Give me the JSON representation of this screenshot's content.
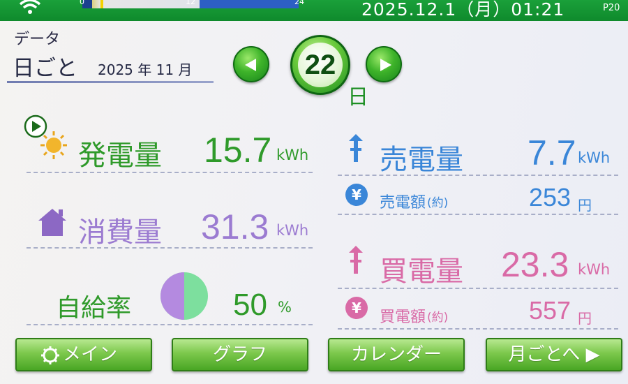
{
  "status_bar": {
    "timeline_ticks": [
      "0",
      "12",
      "24"
    ],
    "datetime": "2025.12.1（月）01:21",
    "page_id": "P20"
  },
  "header": {
    "section": "データ",
    "mode": "日ごと",
    "year_month": "2025 年 11 月",
    "day": "22",
    "day_unit": "日"
  },
  "metrics": {
    "generation": {
      "label": "発電量",
      "value": "15.7",
      "unit": "kWh"
    },
    "consumption": {
      "label": "消費量",
      "value": "31.3",
      "unit": "kWh"
    },
    "self_sufficiency": {
      "label": "自給率",
      "value": "50",
      "unit": "%",
      "fraction": 0.5
    },
    "sold": {
      "label": "売電量",
      "value": "7.7",
      "unit": "kWh"
    },
    "sold_amount": {
      "label": "売電額",
      "note": "(約)",
      "value": "253",
      "unit": "円"
    },
    "bought": {
      "label": "買電量",
      "value": "23.3",
      "unit": "kWh"
    },
    "bought_amount": {
      "label": "買電額",
      "note": "(約)",
      "value": "557",
      "unit": "円"
    }
  },
  "buttons": {
    "main": "メイン",
    "graph": "グラフ",
    "calendar": "カレンダー",
    "monthly": "月ごとへ ▶"
  },
  "icons": [
    "wifi-icon",
    "play-icon",
    "sun-icon",
    "house-icon",
    "pie-icon",
    "arrow-up-icon",
    "yen-icon",
    "arrow-down-icon",
    "prev-arrow-icon",
    "next-arrow-icon",
    "gear-icon"
  ],
  "colors": {
    "generation": "#2f9a2a",
    "consumption": "#9b7bd1",
    "sold": "#3a86d8",
    "bought": "#d96aa6",
    "button": "#5db22f"
  }
}
